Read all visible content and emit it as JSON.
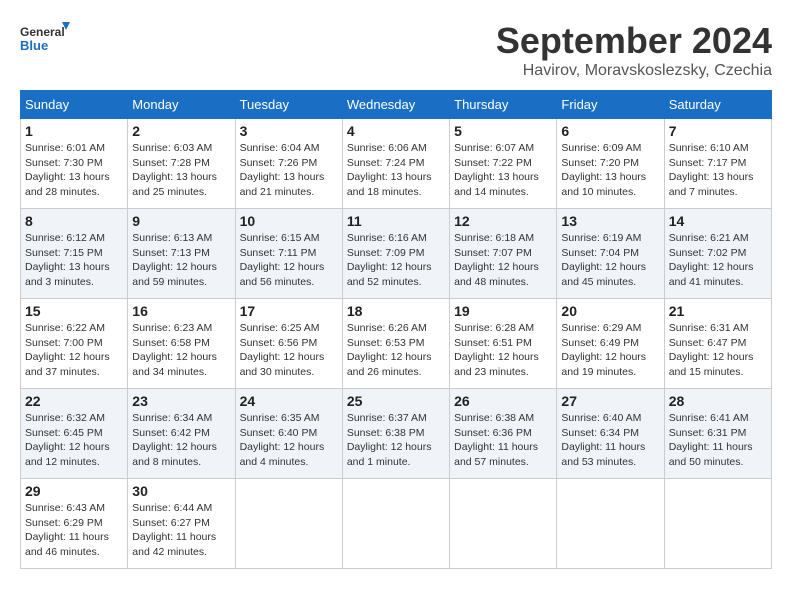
{
  "logo": {
    "line1": "General",
    "line2": "Blue"
  },
  "title": "September 2024",
  "subtitle": "Havirov, Moravskoslezsky, Czechia",
  "days_header": [
    "Sunday",
    "Monday",
    "Tuesday",
    "Wednesday",
    "Thursday",
    "Friday",
    "Saturday"
  ],
  "weeks": [
    [
      {
        "day": "1",
        "sunrise": "6:01 AM",
        "sunset": "7:30 PM",
        "daylight": "13 hours and 28 minutes."
      },
      {
        "day": "2",
        "sunrise": "6:03 AM",
        "sunset": "7:28 PM",
        "daylight": "13 hours and 25 minutes."
      },
      {
        "day": "3",
        "sunrise": "6:04 AM",
        "sunset": "7:26 PM",
        "daylight": "13 hours and 21 minutes."
      },
      {
        "day": "4",
        "sunrise": "6:06 AM",
        "sunset": "7:24 PM",
        "daylight": "13 hours and 18 minutes."
      },
      {
        "day": "5",
        "sunrise": "6:07 AM",
        "sunset": "7:22 PM",
        "daylight": "13 hours and 14 minutes."
      },
      {
        "day": "6",
        "sunrise": "6:09 AM",
        "sunset": "7:20 PM",
        "daylight": "13 hours and 10 minutes."
      },
      {
        "day": "7",
        "sunrise": "6:10 AM",
        "sunset": "7:17 PM",
        "daylight": "13 hours and 7 minutes."
      }
    ],
    [
      {
        "day": "8",
        "sunrise": "6:12 AM",
        "sunset": "7:15 PM",
        "daylight": "13 hours and 3 minutes."
      },
      {
        "day": "9",
        "sunrise": "6:13 AM",
        "sunset": "7:13 PM",
        "daylight": "12 hours and 59 minutes."
      },
      {
        "day": "10",
        "sunrise": "6:15 AM",
        "sunset": "7:11 PM",
        "daylight": "12 hours and 56 minutes."
      },
      {
        "day": "11",
        "sunrise": "6:16 AM",
        "sunset": "7:09 PM",
        "daylight": "12 hours and 52 minutes."
      },
      {
        "day": "12",
        "sunrise": "6:18 AM",
        "sunset": "7:07 PM",
        "daylight": "12 hours and 48 minutes."
      },
      {
        "day": "13",
        "sunrise": "6:19 AM",
        "sunset": "7:04 PM",
        "daylight": "12 hours and 45 minutes."
      },
      {
        "day": "14",
        "sunrise": "6:21 AM",
        "sunset": "7:02 PM",
        "daylight": "12 hours and 41 minutes."
      }
    ],
    [
      {
        "day": "15",
        "sunrise": "6:22 AM",
        "sunset": "7:00 PM",
        "daylight": "12 hours and 37 minutes."
      },
      {
        "day": "16",
        "sunrise": "6:23 AM",
        "sunset": "6:58 PM",
        "daylight": "12 hours and 34 minutes."
      },
      {
        "day": "17",
        "sunrise": "6:25 AM",
        "sunset": "6:56 PM",
        "daylight": "12 hours and 30 minutes."
      },
      {
        "day": "18",
        "sunrise": "6:26 AM",
        "sunset": "6:53 PM",
        "daylight": "12 hours and 26 minutes."
      },
      {
        "day": "19",
        "sunrise": "6:28 AM",
        "sunset": "6:51 PM",
        "daylight": "12 hours and 23 minutes."
      },
      {
        "day": "20",
        "sunrise": "6:29 AM",
        "sunset": "6:49 PM",
        "daylight": "12 hours and 19 minutes."
      },
      {
        "day": "21",
        "sunrise": "6:31 AM",
        "sunset": "6:47 PM",
        "daylight": "12 hours and 15 minutes."
      }
    ],
    [
      {
        "day": "22",
        "sunrise": "6:32 AM",
        "sunset": "6:45 PM",
        "daylight": "12 hours and 12 minutes."
      },
      {
        "day": "23",
        "sunrise": "6:34 AM",
        "sunset": "6:42 PM",
        "daylight": "12 hours and 8 minutes."
      },
      {
        "day": "24",
        "sunrise": "6:35 AM",
        "sunset": "6:40 PM",
        "daylight": "12 hours and 4 minutes."
      },
      {
        "day": "25",
        "sunrise": "6:37 AM",
        "sunset": "6:38 PM",
        "daylight": "12 hours and 1 minute."
      },
      {
        "day": "26",
        "sunrise": "6:38 AM",
        "sunset": "6:36 PM",
        "daylight": "11 hours and 57 minutes."
      },
      {
        "day": "27",
        "sunrise": "6:40 AM",
        "sunset": "6:34 PM",
        "daylight": "11 hours and 53 minutes."
      },
      {
        "day": "28",
        "sunrise": "6:41 AM",
        "sunset": "6:31 PM",
        "daylight": "11 hours and 50 minutes."
      }
    ],
    [
      {
        "day": "29",
        "sunrise": "6:43 AM",
        "sunset": "6:29 PM",
        "daylight": "11 hours and 46 minutes."
      },
      {
        "day": "30",
        "sunrise": "6:44 AM",
        "sunset": "6:27 PM",
        "daylight": "11 hours and 42 minutes."
      },
      null,
      null,
      null,
      null,
      null
    ]
  ]
}
